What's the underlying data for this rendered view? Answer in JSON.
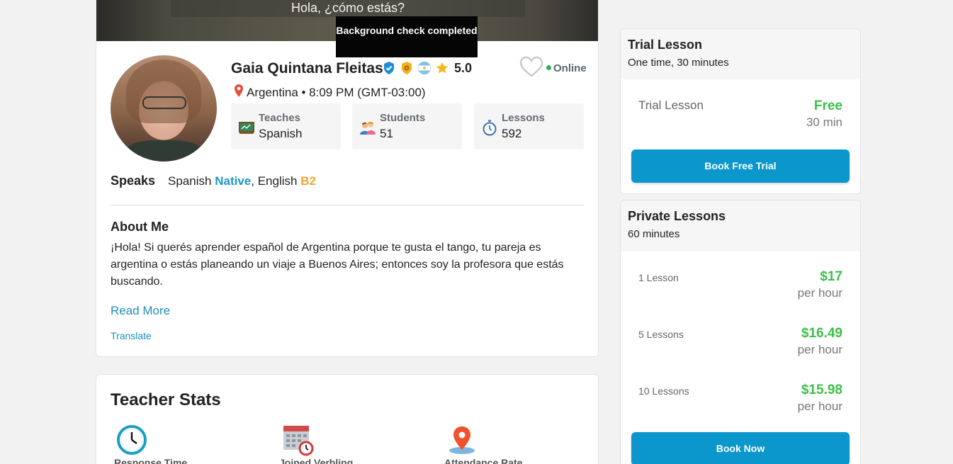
{
  "video": {
    "caption": "Hola, ¿cómo estás?"
  },
  "tooltip": {
    "text": "Background check completed"
  },
  "profile": {
    "name": "Gaia Quintana Fleitas",
    "rating": "5.0",
    "online": "Online",
    "location": "Argentina • 8:09 PM (GMT-03:00)",
    "stats": [
      {
        "label": "Teaches",
        "value": "Spanish",
        "icon": "chalkboard-icon"
      },
      {
        "label": "Students",
        "value": "51",
        "icon": "students-icon"
      },
      {
        "label": "Lessons",
        "value": "592",
        "icon": "stopwatch-icon"
      }
    ],
    "speaks": {
      "title": "Speaks",
      "lang1": "Spanish",
      "lvl1": "Native",
      "sep": ", English",
      "lvl2": "B2"
    },
    "about": {
      "title": "About Me",
      "text": "¡Hola! Si querés aprender español de Argentina porque te gusta el tango, tu pareja es argentina o estás planeando un viaje a Buenos Aires; entonces soy la profesora que estás buscando.",
      "read_more": "Read More",
      "translate": "Translate"
    }
  },
  "teacher_stats": {
    "title": "Teacher Stats",
    "items": [
      {
        "label": "Response Time",
        "icon": "clock-icon"
      },
      {
        "label": "Joined Verbling",
        "icon": "calendar-icon"
      },
      {
        "label": "Attendance Rate",
        "icon": "location-pin-icon"
      }
    ]
  },
  "trial": {
    "title": "Trial Lesson",
    "subtitle": "One time, 30 minutes",
    "row_name": "Trial Lesson",
    "price": "Free",
    "duration": "30 min",
    "button": "Book Free Trial"
  },
  "private": {
    "title": "Private Lessons",
    "subtitle": "60 minutes",
    "rows": [
      {
        "name": "1 Lesson",
        "price": "$17",
        "unit": "per hour"
      },
      {
        "name": "5 Lessons",
        "price": "$16.49",
        "unit": "per hour"
      },
      {
        "name": "10 Lessons",
        "price": "$15.98",
        "unit": "per hour"
      }
    ],
    "button": "Book Now"
  },
  "colors": {
    "accent": "#0b96cc",
    "price_green": "#3bbf4a",
    "native_blue": "#1d97c9",
    "b2_orange": "#f3a630"
  }
}
